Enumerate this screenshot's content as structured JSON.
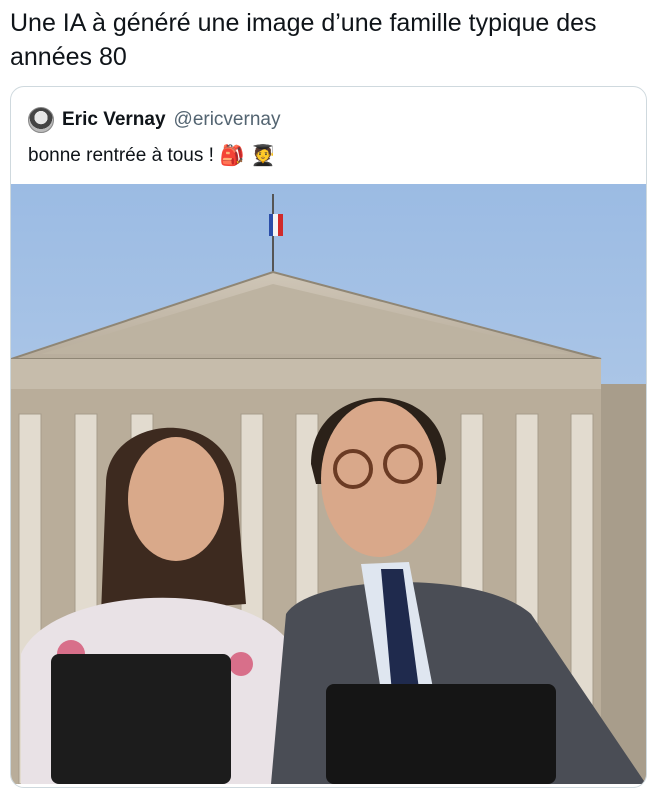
{
  "post": {
    "text": "Une IA à généré une image d’une famille typique des années 80"
  },
  "quote": {
    "author_name": "Eric Vernay",
    "author_handle": "@ericvernay",
    "text": "bonne rentrée à tous !",
    "emoji_1": "🎒",
    "emoji_2": "🧑‍🎓"
  },
  "photo": {
    "description_icon": "photo"
  },
  "colors": {
    "border": "#cfd9de",
    "handle_gray": "#536471",
    "text": "#0f1419"
  }
}
